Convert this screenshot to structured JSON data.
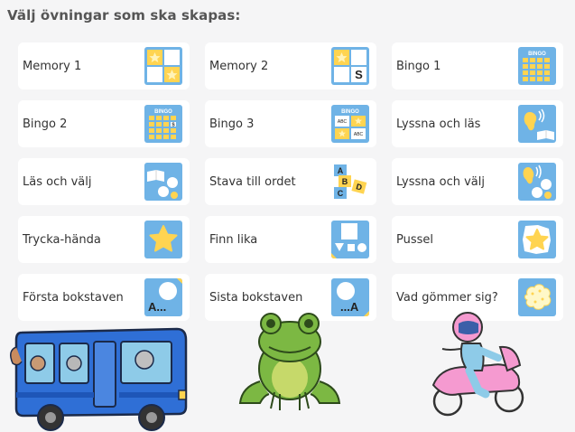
{
  "heading": "Välj övningar som ska skapas:",
  "colors": {
    "thumb_bg": "#6fb3e6",
    "thumb_yellow": "#ffd451",
    "card_bg": "#ffffff",
    "page_bg": "#f5f5f6"
  },
  "exercises": [
    {
      "label": "Memory 1",
      "icon": "memory-1-icon"
    },
    {
      "label": "Memory 2",
      "icon": "memory-2-icon"
    },
    {
      "label": "Bingo 1",
      "icon": "bingo-1-icon"
    },
    {
      "label": "Bingo 2",
      "icon": "bingo-2-icon"
    },
    {
      "label": "Bingo 3",
      "icon": "bingo-3-icon"
    },
    {
      "label": "Lyssna och läs",
      "icon": "listen-read-icon"
    },
    {
      "label": "Läs och välj",
      "icon": "read-choose-icon"
    },
    {
      "label": "Stava till ordet",
      "icon": "spell-word-icon"
    },
    {
      "label": "Lyssna och välj",
      "icon": "listen-choose-icon"
    },
    {
      "label": "Trycka-hända",
      "icon": "star-icon"
    },
    {
      "label": "Finn lika",
      "icon": "find-same-icon"
    },
    {
      "label": "Pussel",
      "icon": "puzzle-icon"
    },
    {
      "label": "Första bokstaven",
      "icon": "first-letter-icon"
    },
    {
      "label": "Sista bokstaven",
      "icon": "last-letter-icon"
    },
    {
      "label": "Vad gömmer sig?",
      "icon": "hidden-icon"
    }
  ],
  "icon_text": {
    "s": "S",
    "bingo": "BINGO",
    "abc": "ABC",
    "a": "A",
    "b": "B",
    "c": "C",
    "d": "D",
    "first": "A...",
    "last": "...A"
  },
  "illustrations": [
    "bus-illustration",
    "frog-illustration",
    "motorcycle-illustration"
  ]
}
